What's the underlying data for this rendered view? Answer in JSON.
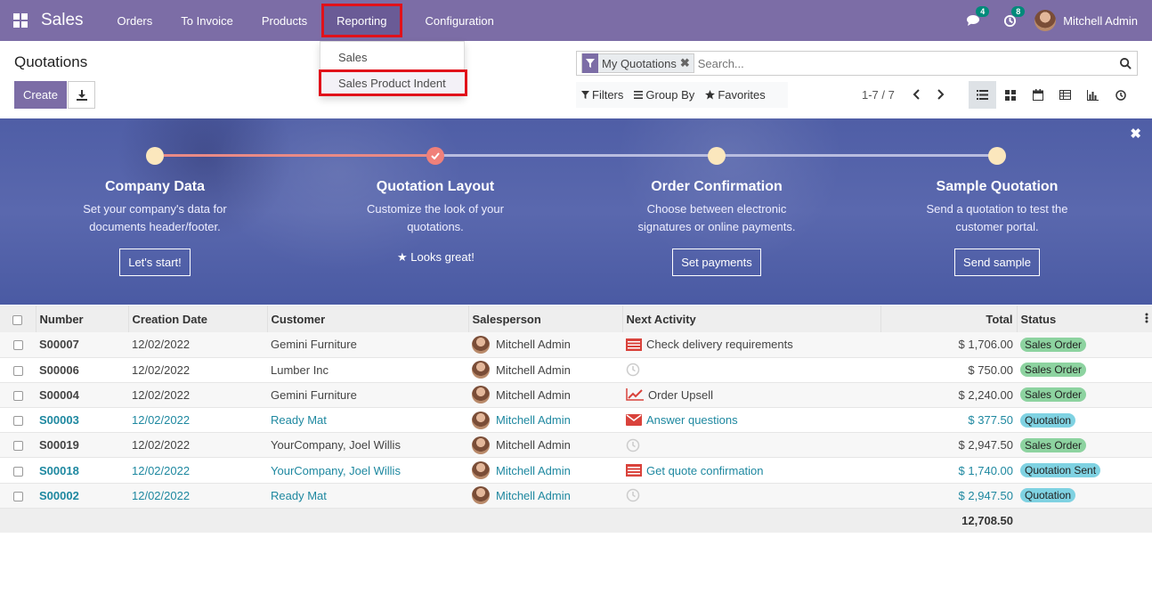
{
  "navbar": {
    "brand": "Sales",
    "menu": [
      "Orders",
      "To Invoice",
      "Products",
      "Reporting",
      "Configuration"
    ],
    "messages_count": "4",
    "activities_count": "8",
    "user": "Mitchell Admin"
  },
  "reporting_menu": [
    "Sales",
    "Sales Product Indent"
  ],
  "control_panel": {
    "title": "Quotations",
    "create_label": "Create",
    "facet": "My Quotations",
    "search_placeholder": "Search...",
    "filters_label": "Filters",
    "groupby_label": "Group By",
    "favorites_label": "Favorites",
    "pager": "1-7 / 7"
  },
  "banner": {
    "steps": [
      {
        "title": "Company Data",
        "desc1": "Set your company's data for",
        "desc2": "documents header/footer.",
        "action": "Let's start!"
      },
      {
        "title": "Quotation Layout",
        "desc1": "Customize the look of your",
        "desc2": "quotations.",
        "action": "Looks great!"
      },
      {
        "title": "Order Confirmation",
        "desc1": "Choose between electronic",
        "desc2": "signatures or online payments.",
        "action": "Set payments"
      },
      {
        "title": "Sample Quotation",
        "desc1": "Send a quotation to test the",
        "desc2": "customer portal.",
        "action": "Send sample"
      }
    ]
  },
  "table": {
    "headers": [
      "Number",
      "Creation Date",
      "Customer",
      "Salesperson",
      "Next Activity",
      "Total",
      "Status"
    ],
    "rows": [
      {
        "number": "S00007",
        "date": "12/02/2022",
        "customer": "Gemini Furniture",
        "salesperson": "Mitchell Admin",
        "activity": "Check delivery requirements",
        "total": "$ 1,706.00",
        "status": "Sales Order"
      },
      {
        "number": "S00006",
        "date": "12/02/2022",
        "customer": "Lumber Inc",
        "salesperson": "Mitchell Admin",
        "activity": "",
        "total": "$ 750.00",
        "status": "Sales Order"
      },
      {
        "number": "S00004",
        "date": "12/02/2022",
        "customer": "Gemini Furniture",
        "salesperson": "Mitchell Admin",
        "activity": "Order Upsell",
        "total": "$ 2,240.00",
        "status": "Sales Order"
      },
      {
        "number": "S00003",
        "date": "12/02/2022",
        "customer": "Ready Mat",
        "salesperson": "Mitchell Admin",
        "activity": "Answer questions",
        "total": "$ 377.50",
        "status": "Quotation"
      },
      {
        "number": "S00019",
        "date": "12/02/2022",
        "customer": "YourCompany, Joel Willis",
        "salesperson": "Mitchell Admin",
        "activity": "",
        "total": "$ 2,947.50",
        "status": "Sales Order"
      },
      {
        "number": "S00018",
        "date": "12/02/2022",
        "customer": "YourCompany, Joel Willis",
        "salesperson": "Mitchell Admin",
        "activity": "Get quote confirmation",
        "total": "$ 1,740.00",
        "status": "Quotation Sent"
      },
      {
        "number": "S00002",
        "date": "12/02/2022",
        "customer": "Ready Mat",
        "salesperson": "Mitchell Admin",
        "activity": "",
        "total": "$ 2,947.50",
        "status": "Quotation"
      }
    ],
    "grand_total": "12,708.50"
  },
  "colors": {
    "brand": "#7c6da6",
    "highlight": "#e1111a",
    "link": "#1e88a0"
  }
}
